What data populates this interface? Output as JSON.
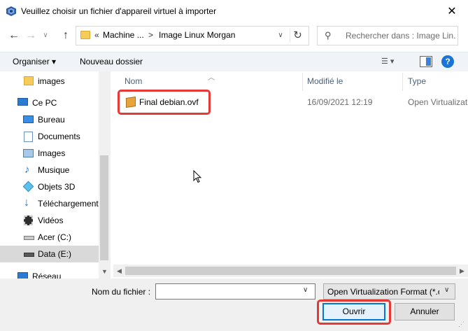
{
  "window": {
    "title": "Veuillez choisir un fichier d'appareil virtuel à importer",
    "close_glyph": "✕",
    "app_icon": "virtualbox-icon"
  },
  "address": {
    "chevrons": "«",
    "crumbs": [
      "Machine ...",
      "Image Linux Morgan"
    ],
    "separator": ">",
    "search_placeholder": "Rechercher dans : Image Lin..."
  },
  "toolbar": {
    "organize_label": "Organiser ▾",
    "new_folder_label": "Nouveau dossier",
    "view_glyph": "☰ ▾",
    "help_glyph": "?"
  },
  "sidebar": {
    "items": [
      {
        "label": "images",
        "icon": "folder-icon"
      },
      {
        "label": "Ce PC",
        "icon": "computer-icon"
      },
      {
        "label": "Bureau",
        "icon": "desktop-icon"
      },
      {
        "label": "Documents",
        "icon": "documents-icon"
      },
      {
        "label": "Images",
        "icon": "pictures-icon"
      },
      {
        "label": "Musique",
        "icon": "music-icon"
      },
      {
        "label": "Objets 3D",
        "icon": "cube-icon"
      },
      {
        "label": "Téléchargements",
        "icon": "download-icon"
      },
      {
        "label": "Vidéos",
        "icon": "video-icon"
      },
      {
        "label": "Acer (C:)",
        "icon": "drive-icon"
      },
      {
        "label": "Data (E:)",
        "icon": "drive-icon",
        "selected": true
      },
      {
        "label": "Réseau",
        "icon": "network-icon"
      }
    ]
  },
  "filelist": {
    "columns": [
      "Nom",
      "Modifié le",
      "Type"
    ],
    "files": [
      {
        "name": "Final debian.ovf",
        "modified": "16/09/2021 12:19",
        "type": "Open Virtualizatio",
        "icon": "ovf-package-icon"
      }
    ]
  },
  "bottom": {
    "filename_label": "Nom du fichier :",
    "filename_value": "",
    "filetype_value": "Open Virtualization Format (*.o",
    "open_label": "Ouvrir",
    "cancel_label": "Annuler"
  },
  "colors": {
    "highlight": "#e53935",
    "accent": "#0078d7"
  }
}
